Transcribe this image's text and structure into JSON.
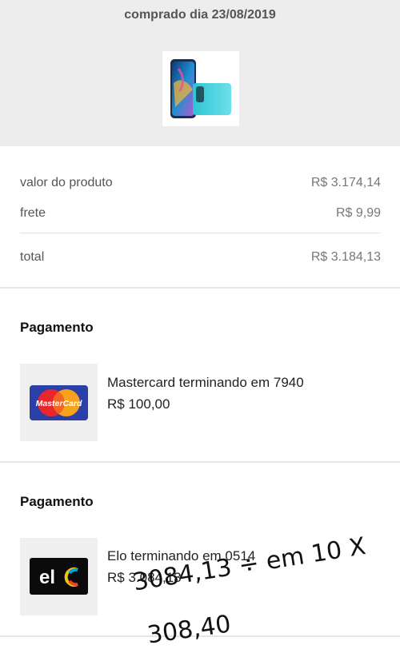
{
  "header": {
    "purchase_date": "comprado dia 23/08/2019",
    "product_image": "phone-product-image"
  },
  "summary": {
    "product_label": "valor do produto",
    "product_value": "R$ 3.174,14",
    "shipping_label": "frete",
    "shipping_value": "R$ 9,99",
    "total_label": "total",
    "total_value": "R$ 3.184,13"
  },
  "payments": [
    {
      "title": "Pagamento",
      "card_brand": "mastercard",
      "logo_text": "MasterCard",
      "card_name": "Mastercard terminando em 7940",
      "amount": "R$ 100,00"
    },
    {
      "title": "Pagamento",
      "card_brand": "elo",
      "logo_text": "elo",
      "card_name": "Elo terminando em 0514",
      "amount": "R$ 3.084,13"
    }
  ],
  "annotation": {
    "line1": "3084,13 ÷ em 10 X",
    "line2": "308,40"
  }
}
